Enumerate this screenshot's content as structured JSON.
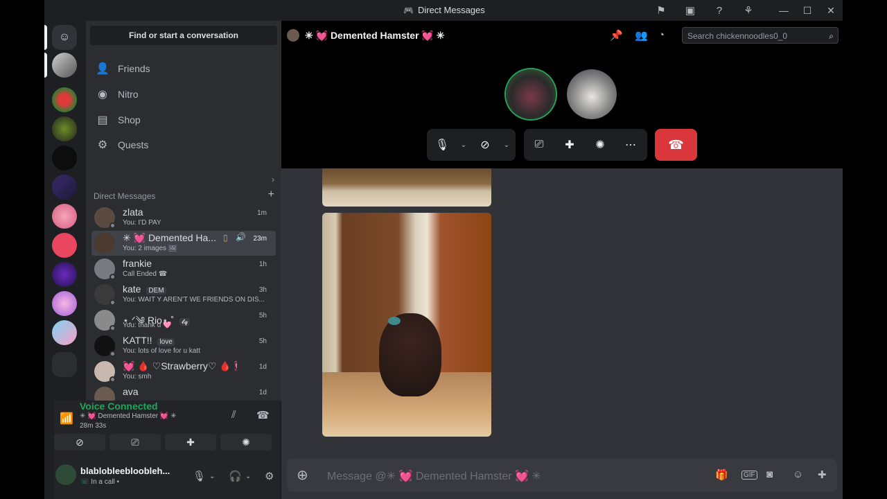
{
  "titlebar": {
    "title": "Direct Messages"
  },
  "sidebar": {
    "search_label": "Find or start a conversation",
    "nav": [
      {
        "label": "Friends",
        "icon": "friends-icon"
      },
      {
        "label": "Nitro",
        "icon": "nitro-icon"
      },
      {
        "label": "Shop",
        "icon": "shop-icon"
      },
      {
        "label": "Quests",
        "icon": "quests-icon"
      }
    ],
    "dm_header": "Direct Messages",
    "dms": [
      {
        "name": "zlata",
        "sub": "You: I'D PAY",
        "time": "1m",
        "color": "#5a4a40"
      },
      {
        "name": "✳ 💓 Demented Ha...",
        "sub": "You: 2 images",
        "time": "23m",
        "color": "#4a3a30",
        "active": true
      },
      {
        "name": "frankie",
        "sub": "Call Ended",
        "time": "1h",
        "color": "#777a80"
      },
      {
        "name": "kate",
        "tag": "DEM",
        "sub": "You: WAIT Y AREN'T WE FRIENDS ON DIS...",
        "time": "3h",
        "color": "#3a3a3a"
      },
      {
        "name": "⋆.ᐟ༄ Rio⋆.˚",
        "tag": "𝓽𝓺",
        "sub": "You: thank u 🩷",
        "time": "5h",
        "color": "#8a8a8a"
      },
      {
        "name": "KATT!!",
        "tag": "love",
        "sub": "You: lots of love for u katt",
        "time": "5h",
        "color": "#111111"
      },
      {
        "name": "💓 🩸 ♡Strawberry♡ 🩸 💓...",
        "sub": "You: smh",
        "time": "1d",
        "color": "#c9b8b0"
      },
      {
        "name": "ava",
        "sub": "",
        "time": "1d",
        "color": "#6a5a50"
      }
    ]
  },
  "voice": {
    "status": "Voice Connected",
    "channel": "✳ 💓 Demented Hamster 💓 ✳",
    "duration": "28m 33s"
  },
  "user": {
    "name": "blablobleebloobleh...",
    "status": "In a call •"
  },
  "main": {
    "channel_title": "✳ 💓 Demented Hamster 💓 ✳",
    "search_placeholder": "Search chickennoodles0_0",
    "composer_placeholder": "Message @✳ 💓 Demented Hamster 💓 ✳"
  },
  "colors": {
    "end_call": "#da373c",
    "voice_green": "#23a55a"
  }
}
